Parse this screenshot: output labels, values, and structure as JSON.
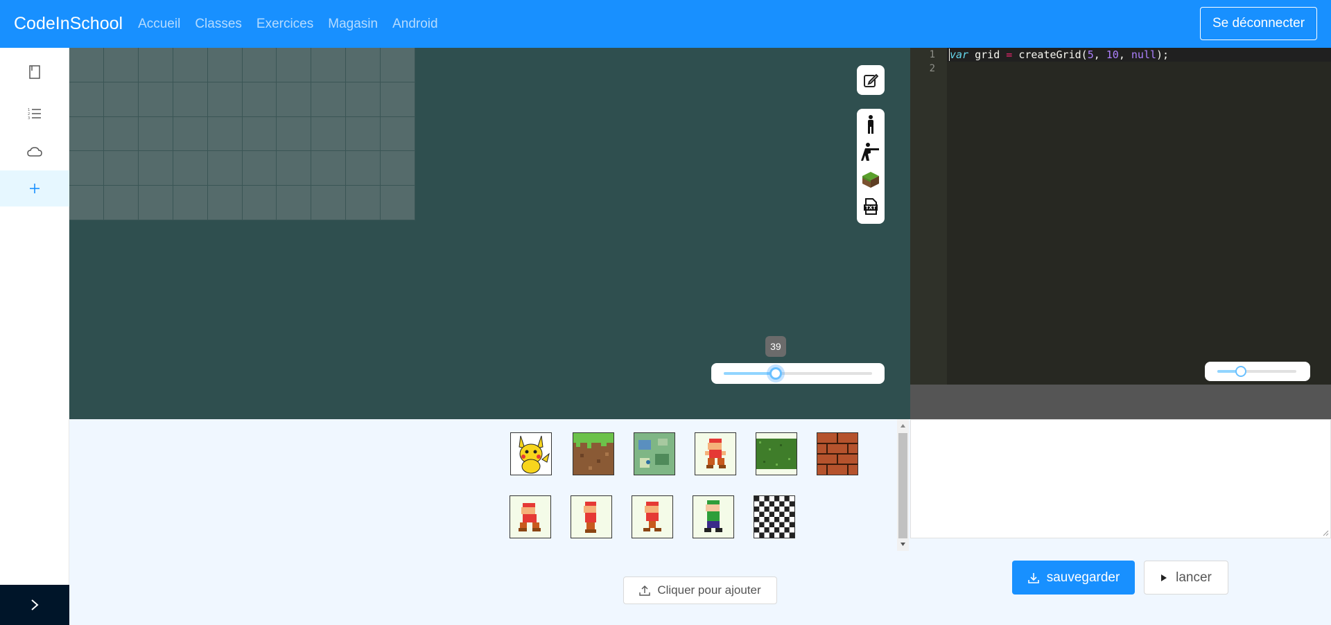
{
  "navbar": {
    "brand": "CodeInSchool",
    "links": [
      "Accueil",
      "Classes",
      "Exercices",
      "Magasin",
      "Android"
    ],
    "logout_label": "Se déconnecter"
  },
  "sidebar": {
    "items": [
      {
        "icon": "book-icon"
      },
      {
        "icon": "ordered-list-icon"
      },
      {
        "icon": "cloud-icon"
      },
      {
        "icon": "plus-icon",
        "active": true
      }
    ],
    "toggle_icon": "chevron-right-icon"
  },
  "canvas": {
    "grid_rows": 5,
    "grid_cols": 10,
    "tools": [
      "edit-icon",
      "person-standing-icon",
      "person-shooting-icon",
      "grass-block-icon",
      "text-file-icon"
    ],
    "zoom_value": "39",
    "zoom_fraction": 0.35
  },
  "editor": {
    "line_numbers": [
      "1",
      "2"
    ],
    "code": "var grid = createGrid(5, 10, null);",
    "font_slider_fraction": 0.3
  },
  "sprites": {
    "row1": [
      "pikachu",
      "grass-dirt-block",
      "map-tile",
      "mario-walking",
      "grass-texture",
      "brick-block"
    ],
    "row2": [
      "mario-1",
      "mario-2",
      "mario-3",
      "luigi",
      "checkerboard"
    ]
  },
  "buttons": {
    "save_label": "sauvegarder",
    "run_label": "lancer",
    "add_label": "Cliquer pour ajouter"
  },
  "colors": {
    "primary": "#1890ff",
    "canvas_bg": "#2f4f4f",
    "editor_bg": "#272822",
    "sidebar_dark": "#001529"
  }
}
